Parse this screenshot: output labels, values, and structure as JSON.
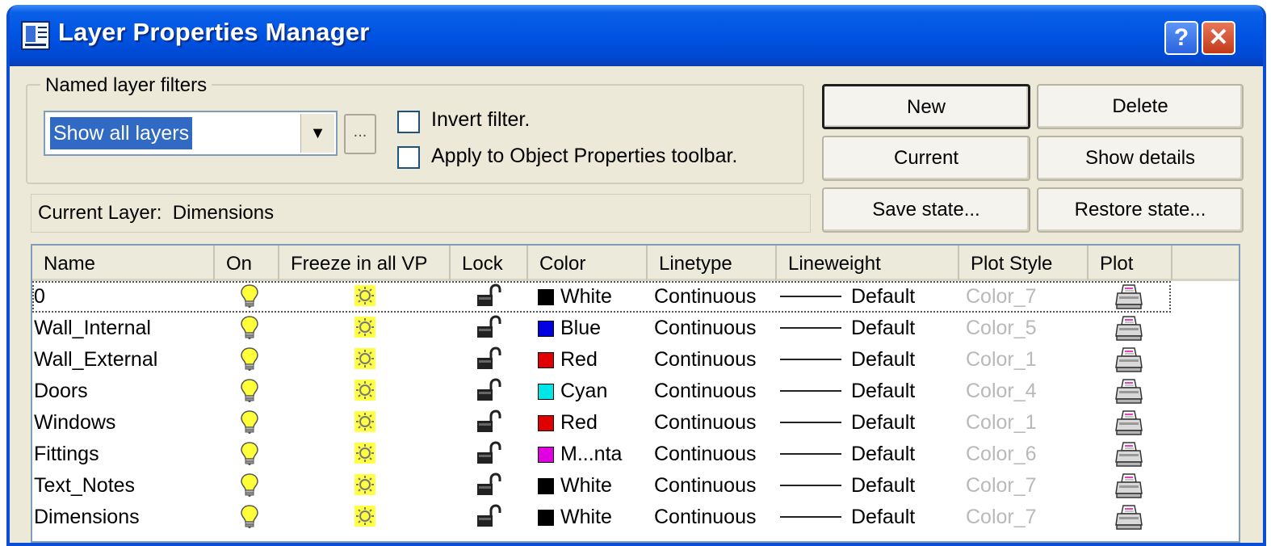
{
  "window": {
    "title": "Layer Properties Manager",
    "help_label": "?",
    "close_label": "✕",
    "title_color": "#0054e3"
  },
  "filters": {
    "group_label": "Named layer filters",
    "selected": "Show all layers",
    "ellipsis_label": "...",
    "invert_label": "Invert filter.",
    "invert_checked": false,
    "apply_label": "Apply to Object Properties toolbar.",
    "apply_checked": false
  },
  "buttons": {
    "new": "New",
    "delete": "Delete",
    "current": "Current",
    "show_details": "Show details",
    "save_state": "Save state...",
    "restore_state": "Restore state..."
  },
  "current_layer": {
    "label": "Current Layer:",
    "value": "Dimensions"
  },
  "table": {
    "columns": [
      "Name",
      "On",
      "Freeze in all VP",
      "Lock",
      "Color",
      "Linetype",
      "Lineweight",
      "Plot Style",
      "Plot"
    ],
    "rows": [
      {
        "name": "0",
        "on": "lightbulb-on-icon",
        "freeze": "sun-thawed-icon",
        "lock": "unlocked-padlock-icon",
        "color": "White",
        "swatch": "#000000",
        "linetype": "Continuous",
        "lineweight": "Default",
        "plot_style": "Color_7",
        "plot": "printer-icon"
      },
      {
        "name": "Wall_Internal",
        "on": "lightbulb-on-icon",
        "freeze": "sun-thawed-icon",
        "lock": "unlocked-padlock-icon",
        "color": "Blue",
        "swatch": "#0000e0",
        "linetype": "Continuous",
        "lineweight": "Default",
        "plot_style": "Color_5",
        "plot": "printer-icon"
      },
      {
        "name": "Wall_External",
        "on": "lightbulb-on-icon",
        "freeze": "sun-thawed-icon",
        "lock": "unlocked-padlock-icon",
        "color": "Red",
        "swatch": "#e00000",
        "linetype": "Continuous",
        "lineweight": "Default",
        "plot_style": "Color_1",
        "plot": "printer-icon"
      },
      {
        "name": "Doors",
        "on": "lightbulb-on-icon",
        "freeze": "sun-thawed-icon",
        "lock": "unlocked-padlock-icon",
        "color": "Cyan",
        "swatch": "#00e6e6",
        "linetype": "Continuous",
        "lineweight": "Default",
        "plot_style": "Color_4",
        "plot": "printer-icon"
      },
      {
        "name": "Windows",
        "on": "lightbulb-on-icon",
        "freeze": "sun-thawed-icon",
        "lock": "unlocked-padlock-icon",
        "color": "Red",
        "swatch": "#e00000",
        "linetype": "Continuous",
        "lineweight": "Default",
        "plot_style": "Color_1",
        "plot": "printer-icon"
      },
      {
        "name": "Fittings",
        "on": "lightbulb-on-icon",
        "freeze": "sun-thawed-icon",
        "lock": "unlocked-padlock-icon",
        "color": "M...nta",
        "swatch": "#e000e0",
        "linetype": "Continuous",
        "lineweight": "Default",
        "plot_style": "Color_6",
        "plot": "printer-icon"
      },
      {
        "name": "Text_Notes",
        "on": "lightbulb-on-icon",
        "freeze": "sun-thawed-icon",
        "lock": "unlocked-padlock-icon",
        "color": "White",
        "swatch": "#000000",
        "linetype": "Continuous",
        "lineweight": "Default",
        "plot_style": "Color_7",
        "plot": "printer-icon"
      },
      {
        "name": "Dimensions",
        "on": "lightbulb-on-icon",
        "freeze": "sun-thawed-icon",
        "lock": "unlocked-padlock-icon",
        "color": "White",
        "swatch": "#000000",
        "linetype": "Continuous",
        "lineweight": "Default",
        "plot_style": "Color_7",
        "plot": "printer-icon"
      }
    ]
  }
}
